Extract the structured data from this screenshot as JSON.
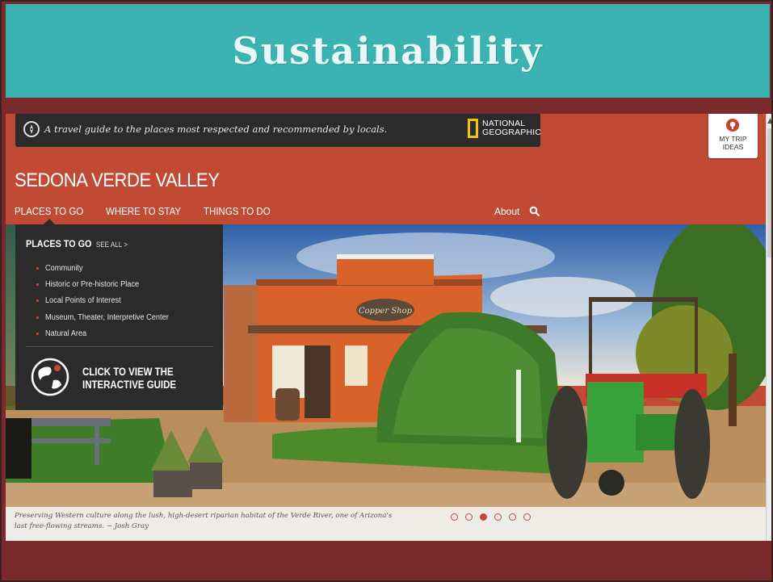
{
  "slide": {
    "title": "Sustainability",
    "colors": {
      "title_bar": "#3bb3b2",
      "background": "#7a2a2a"
    }
  },
  "browser": {
    "topbar": {
      "tagline": "A travel guide to the places most respected and recommended by locals.",
      "brand_line1": "NATIONAL",
      "brand_line2": "GEOGRAPHIC"
    },
    "my_trip": {
      "line1": "MY TRIP",
      "line2": "IDEAS",
      "icon": "lightbulb-pin-icon"
    },
    "site_title": "SEDONA VERDE VALLEY",
    "nav": {
      "items": [
        "PLACES TO GO",
        "WHERE TO STAY",
        "THINGS TO DO"
      ],
      "about": "About",
      "search_icon": "search-icon"
    },
    "dropdown": {
      "heading": "PLACES TO GO",
      "see_all": "SEE ALL >",
      "items": [
        "Community",
        "Historic or Pre-historic Place",
        "Local Points of Interest",
        "Museum, Theater, Interpretive Center",
        "Natural Area"
      ],
      "cta_line1": "CLICK TO VIEW THE",
      "cta_line2": "INTERACTIVE GUIDE",
      "cta_icon": "globe-icon"
    },
    "hero": {
      "sign_text": "Copper Shop"
    },
    "caption": "Preserving Western culture along the lush, high-desert riparian habitat of the Verde River, one of Arizona's last free-flowing streams. ~ Josh Gray",
    "carousel": {
      "count": 6,
      "active_index": 2
    },
    "colors": {
      "brand_red": "#c14a35",
      "dark_bar": "#2b2b2b",
      "natgeo_yellow": "#f5c400"
    }
  }
}
